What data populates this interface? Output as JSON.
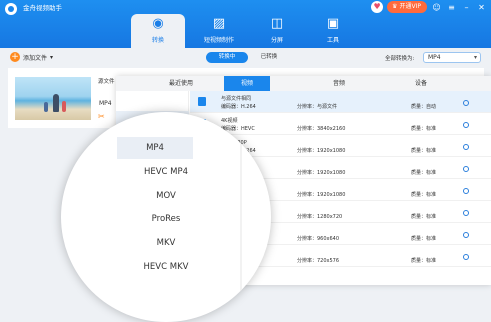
{
  "app": {
    "title": "金舟视频助手"
  },
  "titlebar": {
    "vip_label": "开通VIP"
  },
  "nav": {
    "tabs": [
      {
        "label": "转换",
        "icon": "convert-disc-icon"
      },
      {
        "label": "短视频制作",
        "icon": "image-editor-icon"
      },
      {
        "label": "分屏",
        "icon": "split-screen-icon"
      },
      {
        "label": "工具",
        "icon": "toolbox-icon"
      }
    ]
  },
  "toolbar": {
    "add_label": "添加文件",
    "segments": [
      "转换中",
      "已转换"
    ],
    "format_label": "全部转换为:",
    "format_value": "MP4"
  },
  "file": {
    "source_label": "源文件",
    "format": "MP4"
  },
  "popup": {
    "tabs": [
      "最近使用",
      "视频",
      "音频",
      "设备"
    ],
    "left_selected": "MP4",
    "rows": [
      {
        "name": "与源文件相同",
        "codec": "编码器：H.264",
        "res": "分辨率：与源文件",
        "quality": "质量：自动"
      },
      {
        "name": "4K视频",
        "codec": "编码器：HEVC",
        "res": "分辨率：3840x2160",
        "quality": "质量：标准"
      },
      {
        "name": "高清1080P",
        "codec": "编码器：H.264",
        "res": "分辨率：1920x1080",
        "quality": "质量：标准"
      },
      {
        "name": "",
        "codec": "264",
        "res": "分辨率：1920x1080",
        "quality": "质量：标准"
      },
      {
        "name": "",
        "codec": "4",
        "res": "分辨率：1920x1080",
        "quality": "质量：标准"
      },
      {
        "name": "",
        "codec": "264",
        "res": "分辨率：1280x720",
        "quality": "质量：标准"
      },
      {
        "name": "",
        "codec": "4",
        "res": "分辨率：960x640",
        "quality": "质量：标准"
      },
      {
        "name": "",
        "codec": "264",
        "res": "分辨率：720x576",
        "quality": "质量：标准"
      }
    ]
  },
  "magnifier": {
    "items": [
      "MP4",
      "HEVC MP4",
      "MOV",
      "ProRes",
      "MKV",
      "HEVC MKV"
    ]
  }
}
